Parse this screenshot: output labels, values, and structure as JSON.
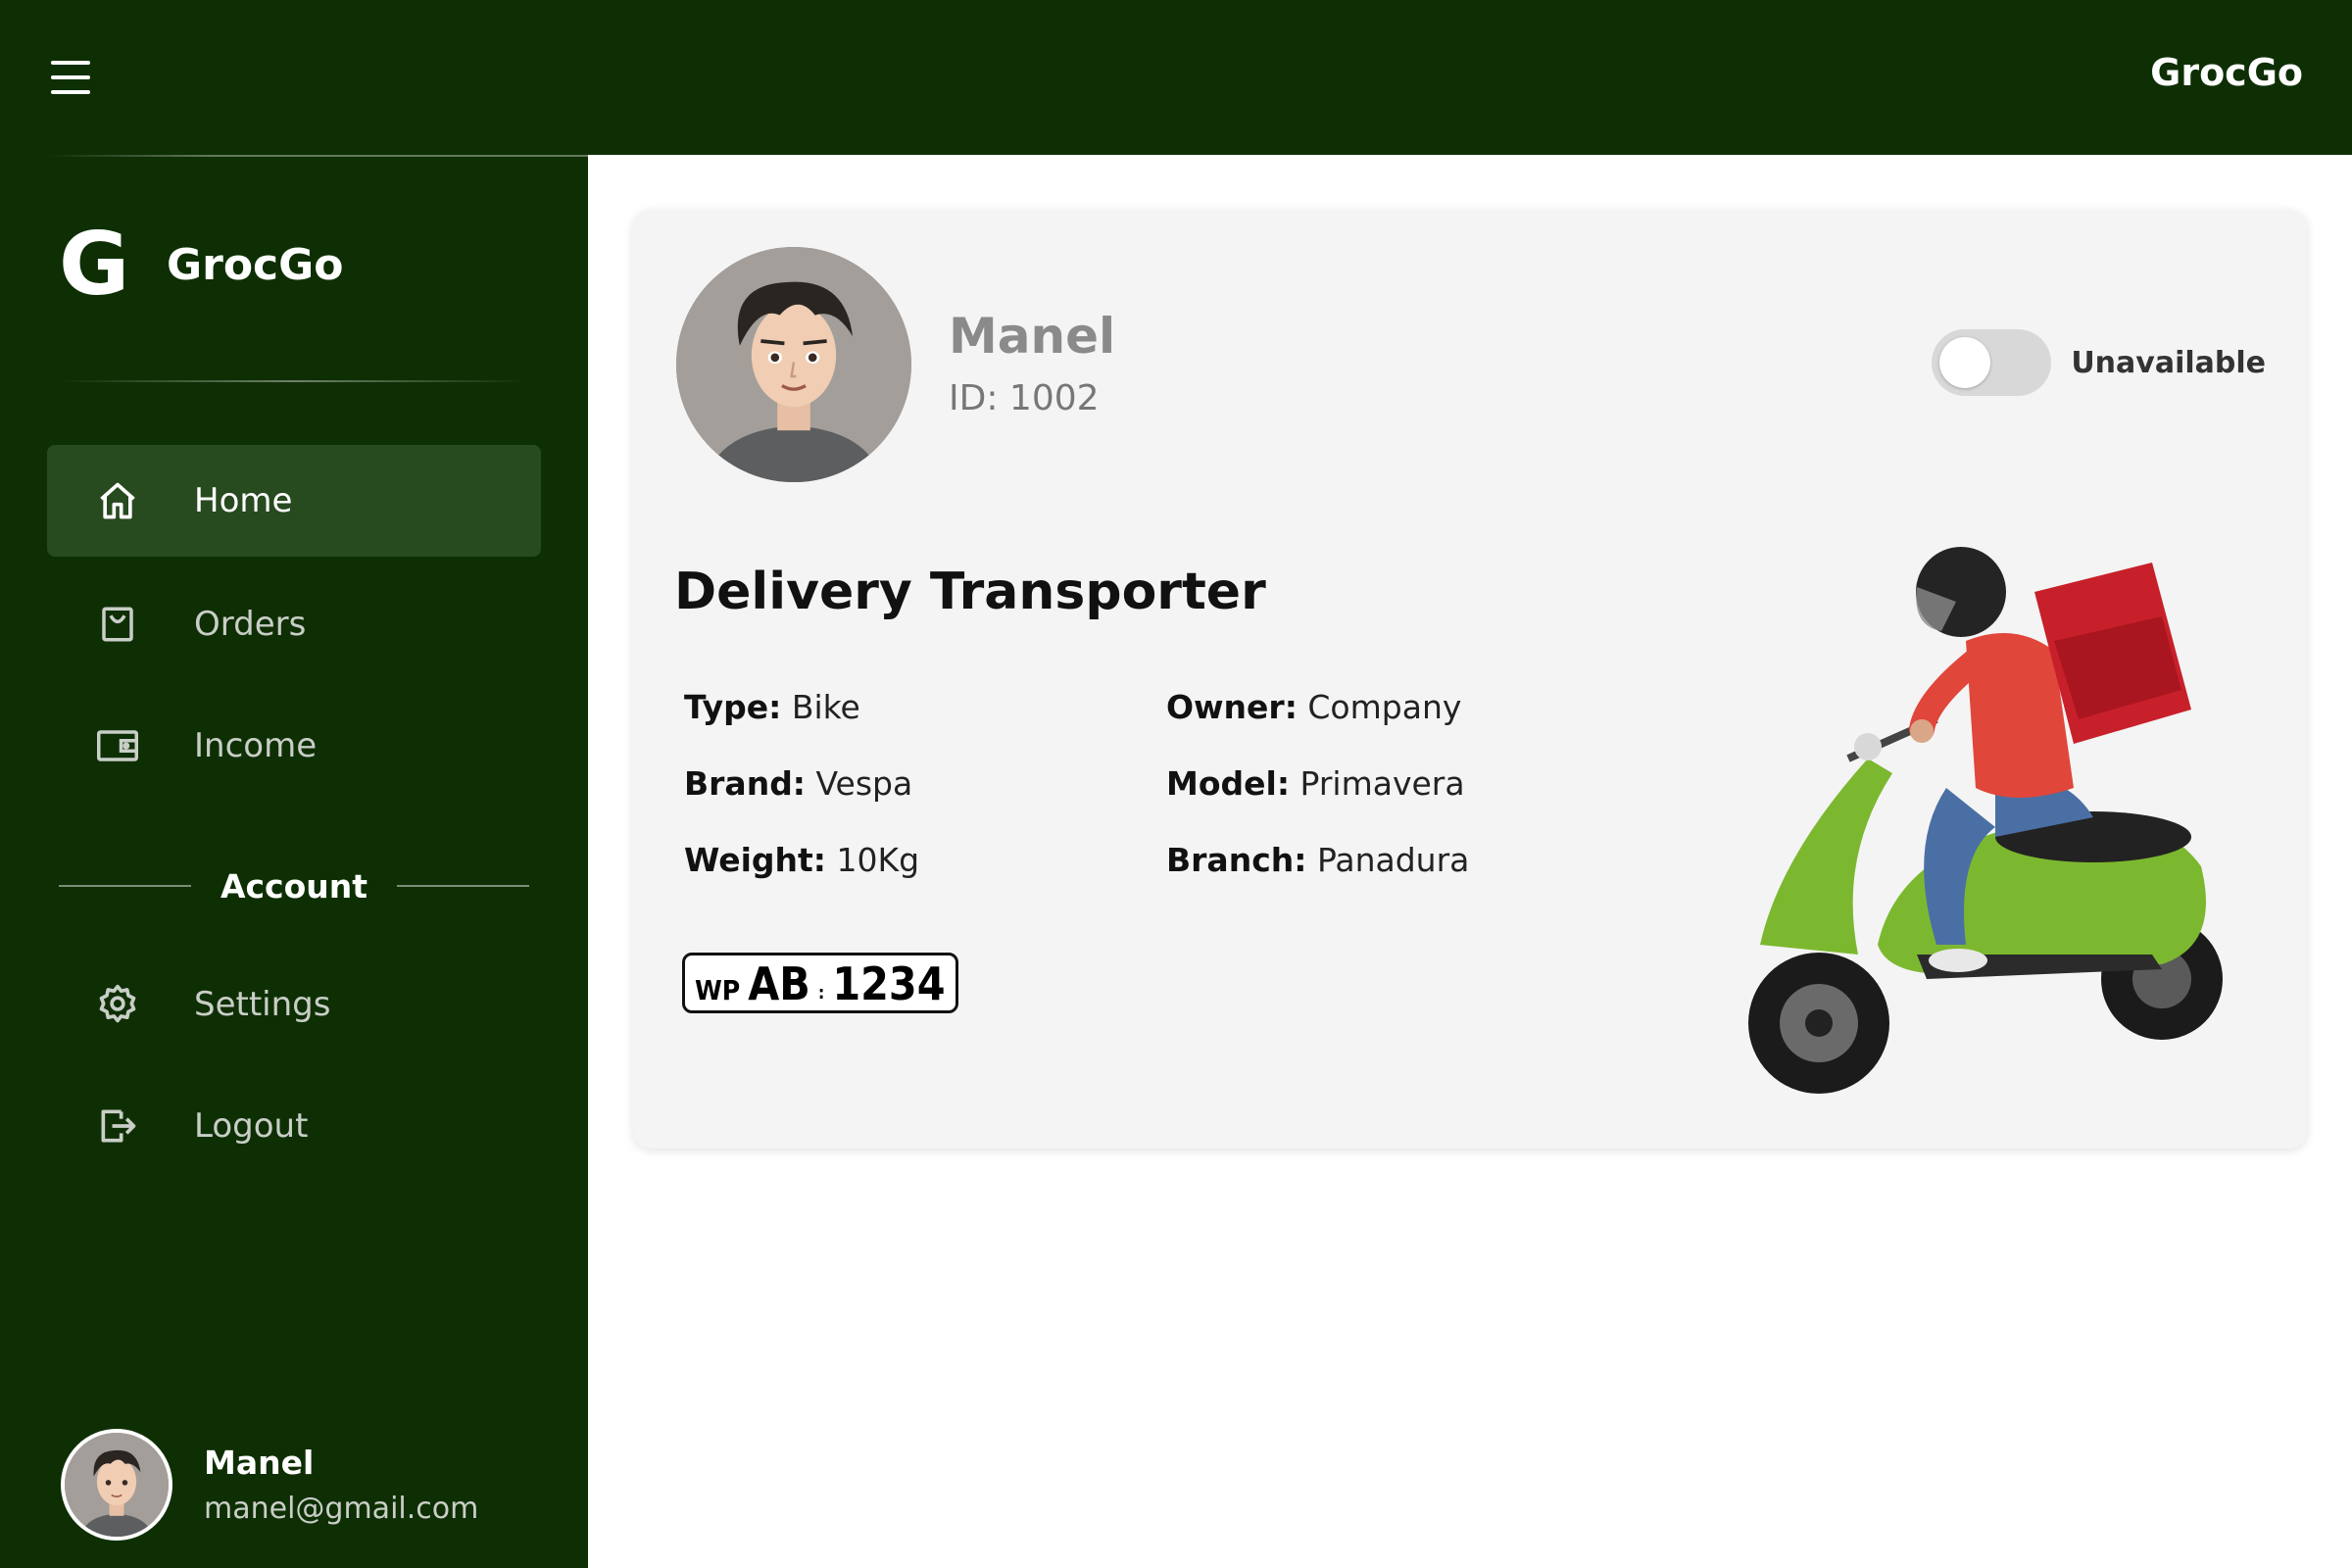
{
  "header": {
    "brand": "GrocGo"
  },
  "sidebar": {
    "brand_mark": "G",
    "brand_name": "GrocGo",
    "items": [
      {
        "label": "Home",
        "icon": "home-icon",
        "active": true
      },
      {
        "label": "Orders",
        "icon": "shopping-bag-icon",
        "active": false
      },
      {
        "label": "Income",
        "icon": "wallet-icon",
        "active": false
      }
    ],
    "account_heading": "Account",
    "account_items": [
      {
        "label": "Settings",
        "icon": "gear-icon"
      },
      {
        "label": "Logout",
        "icon": "logout-icon"
      }
    ],
    "user": {
      "name": "Manel",
      "email": "manel@gmail.com"
    }
  },
  "profile": {
    "name": "Manel",
    "id": "ID: 1002",
    "availability_label": "Unavailable",
    "available": false
  },
  "transporter": {
    "title": "Delivery Transporter",
    "fields": {
      "type": {
        "label": "Type:",
        "value": "Bike"
      },
      "owner": {
        "label": "Owner:",
        "value": "Company"
      },
      "brand": {
        "label": "Brand:",
        "value": "Vespa"
      },
      "model": {
        "label": "Model:",
        "value": "Primavera"
      },
      "weight": {
        "label": "Weight:",
        "value": "10Kg"
      },
      "branch": {
        "label": "Branch:",
        "value": "Panadura"
      }
    },
    "plate": {
      "province": "WP",
      "letters": "AB",
      "divider": ":",
      "number": "1234"
    }
  },
  "colors": {
    "primary": "#0e2f04",
    "active_nav": "#274a1f",
    "card": "#f4f4f4",
    "scooter": "#7cb82f"
  }
}
